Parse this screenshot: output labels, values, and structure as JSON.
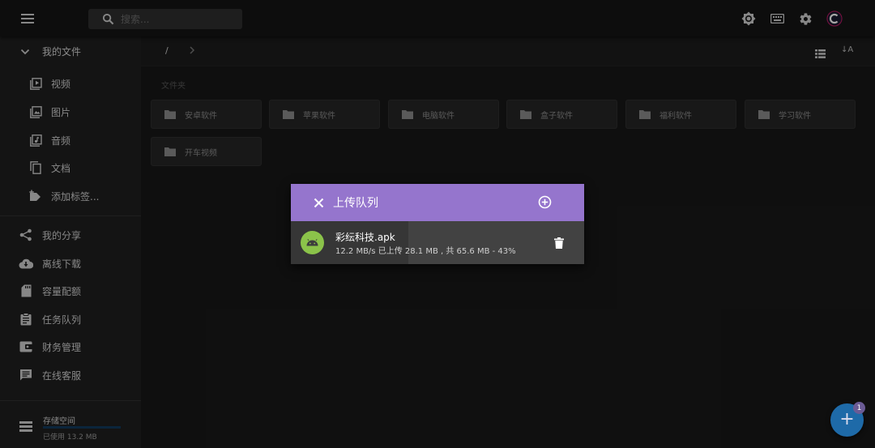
{
  "topbar": {
    "search_placeholder": "搜索...",
    "icons": [
      "menu-icon",
      "search-icon",
      "brightness-icon",
      "keyboard-icon",
      "settings-icon",
      "avatar-icon"
    ]
  },
  "sidebar": {
    "header": "我的文件",
    "sub_items": [
      {
        "label": "视频",
        "icon": "video-icon"
      },
      {
        "label": "图片",
        "icon": "image-icon"
      },
      {
        "label": "音频",
        "icon": "audio-icon"
      },
      {
        "label": "文档",
        "icon": "document-icon"
      },
      {
        "label": "添加标签...",
        "icon": "tag-add-icon"
      }
    ],
    "main_items": [
      {
        "label": "我的分享",
        "icon": "share-icon"
      },
      {
        "label": "离线下载",
        "icon": "cloud-download-icon"
      },
      {
        "label": "容量配额",
        "icon": "sd-card-icon"
      },
      {
        "label": "任务队列",
        "icon": "clipboard-icon"
      },
      {
        "label": "财务管理",
        "icon": "wallet-icon"
      },
      {
        "label": "在线客服",
        "icon": "chat-icon"
      }
    ],
    "storage": {
      "title": "存储空间",
      "used": "已使用 13.2 MB",
      "used_fraction": 1.0
    }
  },
  "navbar": {
    "path": "/",
    "sort_label": "↓A"
  },
  "folders_section": "文件夹",
  "folders": [
    {
      "name": "安卓软件"
    },
    {
      "name": "苹果软件"
    },
    {
      "name": "电脑软件"
    },
    {
      "name": "盒子软件"
    },
    {
      "name": "福利软件"
    },
    {
      "name": "学习软件"
    },
    {
      "name": "开车视频"
    }
  ],
  "upload_dialog": {
    "title": "上传队列",
    "item": {
      "filename": "彩纭科技.apk",
      "status": "12.2 MB/s 已上传 28.1 MB , 共 65.6 MB - 43%",
      "progress": 0.4
    }
  },
  "fab": {
    "badge": "1"
  },
  "colors": {
    "accent": "#9575cd",
    "fab": "#1e6aa8",
    "android": "#8bc34a"
  }
}
